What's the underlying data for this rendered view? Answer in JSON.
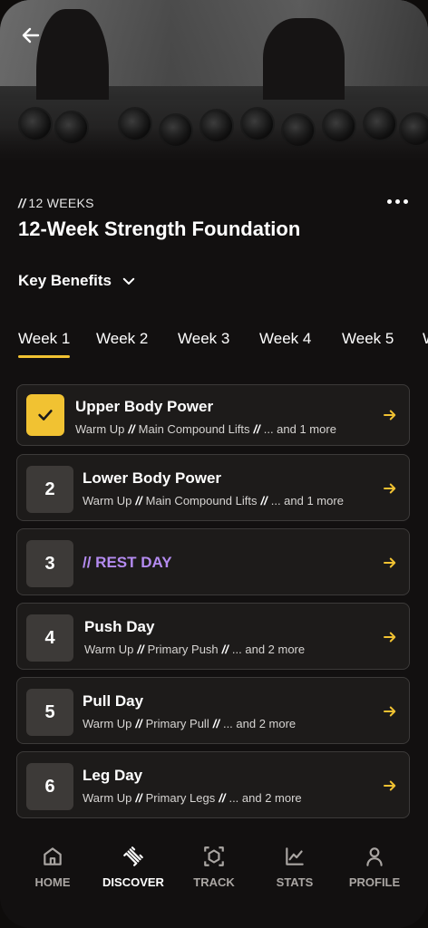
{
  "hero": {
    "image_subject": "gym dumbbell rack with athletes"
  },
  "program": {
    "eyebrow_prefix": "//",
    "eyebrow_text": "12 WEEKS",
    "title": "12-Week Strength Foundation",
    "benefits_label": "Key Benefits"
  },
  "tabs": [
    {
      "label": "Week 1",
      "active": true
    },
    {
      "label": "Week 2",
      "active": false
    },
    {
      "label": "Week 3",
      "active": false
    },
    {
      "label": "Week 4",
      "active": false
    },
    {
      "label": "Week 5",
      "active": false
    },
    {
      "label": "W",
      "active": false
    }
  ],
  "workouts": [
    {
      "badge": "",
      "done": true,
      "title": "Upper Body Power",
      "parts": [
        "Warm Up",
        "Main Compound Lifts",
        "... and 1 more"
      ]
    },
    {
      "badge": "2",
      "done": false,
      "title": "Lower Body Power",
      "parts": [
        "Warm Up",
        "Main Compound Lifts",
        "... and 1 more"
      ]
    },
    {
      "badge": "3",
      "done": false,
      "rest": true,
      "title": "// REST DAY"
    },
    {
      "badge": "4",
      "done": false,
      "title": "Push Day",
      "parts": [
        "Warm Up",
        "Primary Push",
        "... and 2 more"
      ]
    },
    {
      "badge": "5",
      "done": false,
      "title": "Pull Day",
      "parts": [
        "Warm Up",
        "Primary Pull",
        "... and 2 more"
      ]
    },
    {
      "badge": "6",
      "done": false,
      "title": "Leg Day",
      "parts": [
        "Warm Up",
        "Primary Legs",
        "... and 2 more"
      ]
    }
  ],
  "separator": "//",
  "nav": [
    {
      "label": "HOME",
      "icon": "home-icon",
      "active": false
    },
    {
      "label": "DISCOVER",
      "icon": "dumbbell-icon",
      "active": true
    },
    {
      "label": "TRACK",
      "icon": "cube-icon",
      "active": false
    },
    {
      "label": "STATS",
      "icon": "chart-icon",
      "active": false
    },
    {
      "label": "PROFILE",
      "icon": "person-icon",
      "active": false
    }
  ],
  "colors": {
    "accent": "#f1c232",
    "rest": "#b48bf0",
    "background": "#121010",
    "card": "#1d1b1a"
  }
}
